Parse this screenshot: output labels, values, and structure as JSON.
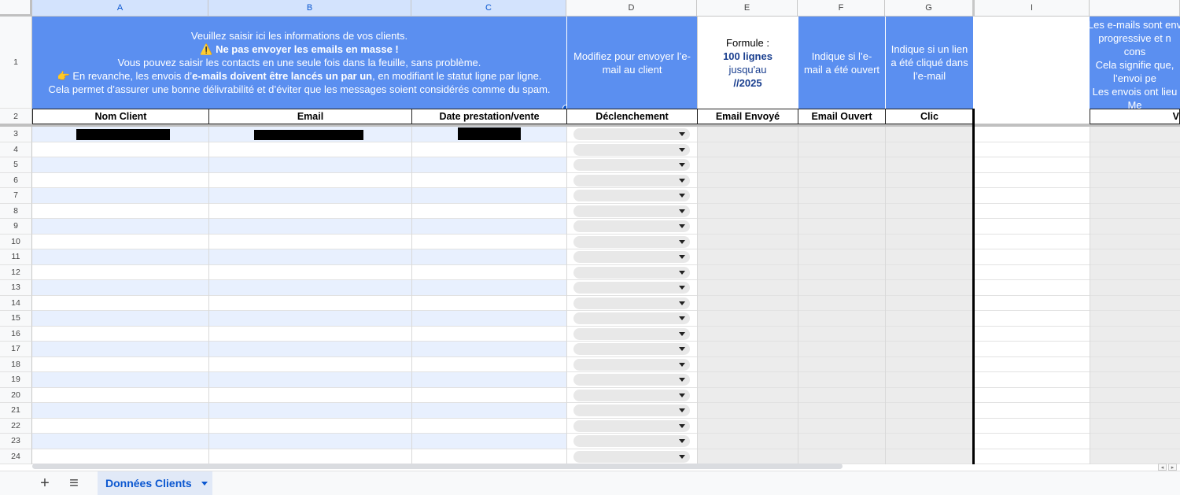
{
  "columns": [
    "A",
    "B",
    "C",
    "D",
    "E",
    "F",
    "G",
    "I"
  ],
  "row_numbers": [
    "1",
    "2",
    "3",
    "4",
    "5",
    "6",
    "7",
    "8",
    "9",
    "10",
    "11",
    "12",
    "13",
    "14",
    "15",
    "16",
    "17",
    "18",
    "19",
    "20",
    "21",
    "22",
    "23",
    "24"
  ],
  "header_main": {
    "line1": "Veuillez saisir ici les informations de vos clients.",
    "warning_icon": "⚠️",
    "line2": "Ne pas envoyer les emails en masse !",
    "line3": "Vous pouvez saisir les contacts en une seule fois dans la feuille, sans problème.",
    "pointer_icon": "👉",
    "line4_a": "En revanche, les envois d’",
    "line4_b": "e-mails doivent être lancés un par un",
    "line4_c": ", en modifiant le statut ligne par ligne.",
    "line5": "Cela permet d’assurer une bonne délivrabilité et d’éviter que les messages soient considérés comme du spam."
  },
  "header_d": "Modifiez pour envoyer l’e-mail au client",
  "header_e": {
    "l1": "Formule :",
    "l2": "100 lignes",
    "l3": "jusqu'au",
    "l4": "//2025"
  },
  "header_f": "Indique si l’e-mail a été ouvert",
  "header_g": "Indique si un lien a été cliqué dans l’e-mail",
  "header_j_lines": [
    "Les e-mails sont env",
    "progressive et n",
    "cons",
    "Cela signifie que,",
    "l’envoi pe",
    "Les envois ont lieu",
    "Me"
  ],
  "col_headers": [
    "Nom Client",
    "Email",
    "Date prestation/vente",
    "Déclenchement",
    "Email Envoyé",
    "Email Ouvert",
    "Clic",
    "V"
  ],
  "bottom": {
    "add": "+",
    "menu": "≡",
    "sheet_tab": "Données Clients"
  },
  "icons": {
    "add": "plus-icon",
    "menu": "menu-icon",
    "tab_menu": "caret-down-icon",
    "dropdown": "caret-down-icon"
  },
  "colors": {
    "header_blue": "#5b8ff0",
    "stripe": "#e8f0fe",
    "gray": "#ececec",
    "navy": "#1a3f8f"
  }
}
